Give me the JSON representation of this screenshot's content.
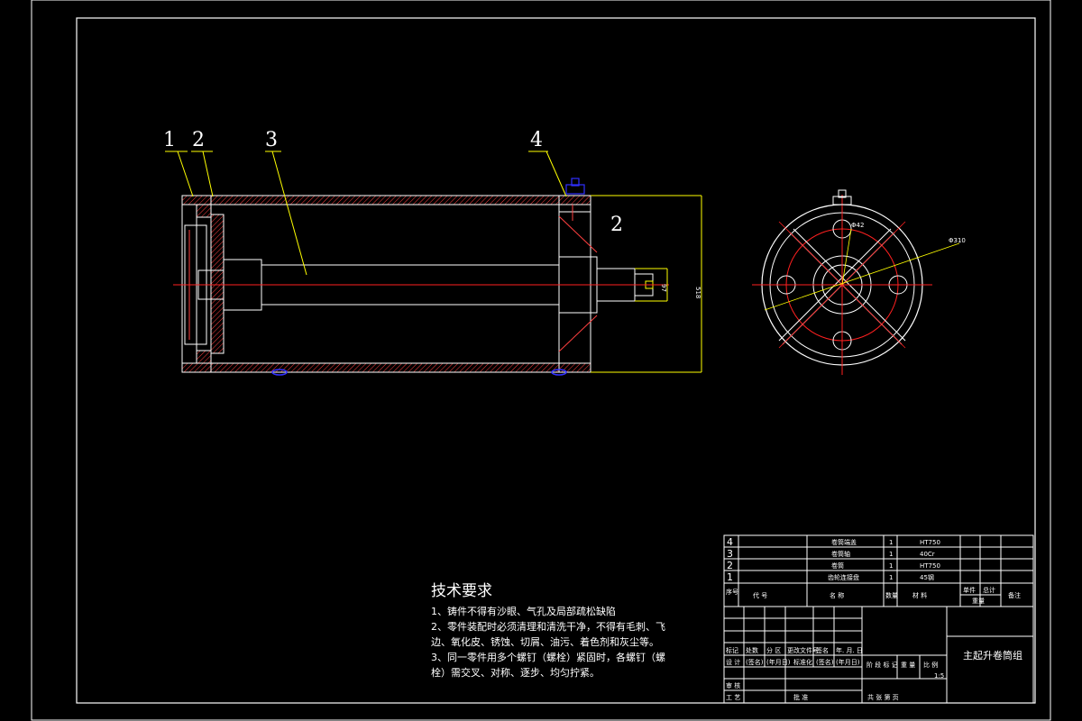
{
  "leaders": {
    "l1": "1",
    "l2": "2",
    "l3": "3",
    "l4": "4",
    "view_mark": "2"
  },
  "dims": {
    "d_shaft": "97",
    "d_length": "518",
    "d_bolt_circle": "Φ42",
    "d_outer": "Φ310"
  },
  "notes": {
    "title": "技术要求",
    "line1": "1、铸件不得有沙眼、气孔及局部疏松缺陷",
    "line2": "2、零件装配时必须清理和清洗干净，不得有毛刺、飞",
    "line3": "边、氧化皮、锈蚀、切屑、油污、着色剂和灰尘等。",
    "line4": "3、同一零件用多个螺钉（螺栓）紧固时，各螺钉（螺",
    "line5": "栓）需交叉、对称、逐步、均匀拧紧。"
  },
  "bom": {
    "rows": [
      {
        "no": "4",
        "name": "卷筒端盖",
        "qty": "1",
        "material": "HT750"
      },
      {
        "no": "3",
        "name": "卷筒轴",
        "qty": "1",
        "material": "40Cr"
      },
      {
        "no": "2",
        "name": "卷筒",
        "qty": "1",
        "material": "HT750"
      },
      {
        "no": "1",
        "name": "齿轮连接盘",
        "qty": "1",
        "material": "45钢"
      }
    ],
    "header": {
      "no": "序号",
      "code": "代  号",
      "name": "名  称",
      "qty": "数量",
      "material": "材  料",
      "single": "单件",
      "total": "总计",
      "weight": "重量",
      "remark": "备注"
    }
  },
  "title_block": {
    "drawing_title": "主起升卷筒组",
    "mark": "标记",
    "count": "处数",
    "zone": "分 区",
    "change_doc": "更改文件号",
    "sign": "签名",
    "date": "年. 月. 日",
    "design": "设 计",
    "sign_paren": "(签名)",
    "date_paren": "(年月日)",
    "standard": "标准化",
    "stage": "阶 段 标 记",
    "weight": "重 量",
    "ratio": "比 例",
    "scale": "1:5",
    "check": "审 核",
    "process": "工 艺",
    "approve": "批 准",
    "sheets": "共    张    第    页"
  },
  "colors": {
    "line": "#ffffff",
    "yellow": "#ffff00",
    "red": "#ff2020",
    "blue": "#3030ff",
    "hatch": "#ff4040"
  }
}
